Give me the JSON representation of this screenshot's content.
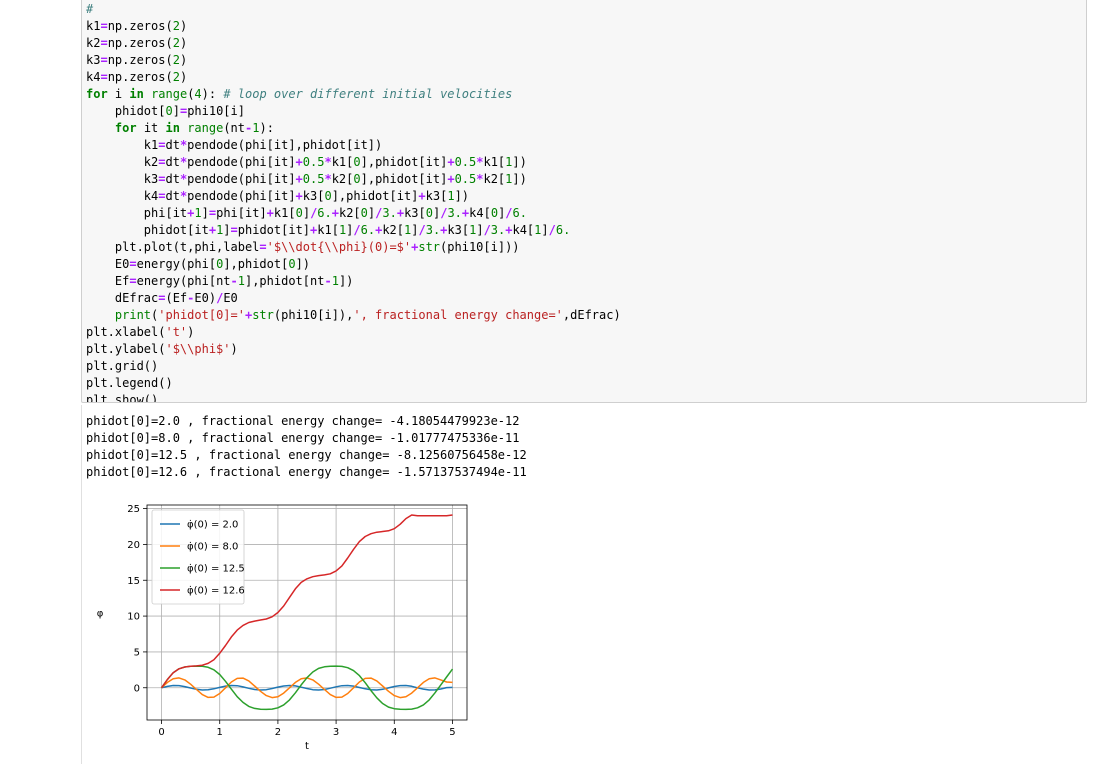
{
  "code_lines": [
    [
      {
        "t": "#",
        "c": "com"
      }
    ],
    [
      {
        "t": "k1",
        "c": ""
      },
      {
        "t": "=",
        "c": "op"
      },
      {
        "t": "np.zeros(",
        "c": ""
      },
      {
        "t": "2",
        "c": "num"
      },
      {
        "t": ")",
        "c": ""
      }
    ],
    [
      {
        "t": "k2",
        "c": ""
      },
      {
        "t": "=",
        "c": "op"
      },
      {
        "t": "np.zeros(",
        "c": ""
      },
      {
        "t": "2",
        "c": "num"
      },
      {
        "t": ")",
        "c": ""
      }
    ],
    [
      {
        "t": "k3",
        "c": ""
      },
      {
        "t": "=",
        "c": "op"
      },
      {
        "t": "np.zeros(",
        "c": ""
      },
      {
        "t": "2",
        "c": "num"
      },
      {
        "t": ")",
        "c": ""
      }
    ],
    [
      {
        "t": "k4",
        "c": ""
      },
      {
        "t": "=",
        "c": "op"
      },
      {
        "t": "np.zeros(",
        "c": ""
      },
      {
        "t": "2",
        "c": "num"
      },
      {
        "t": ")",
        "c": ""
      }
    ],
    [
      {
        "t": "for",
        "c": "kw"
      },
      {
        "t": " i ",
        "c": ""
      },
      {
        "t": "in",
        "c": "kw"
      },
      {
        "t": " ",
        "c": ""
      },
      {
        "t": "range",
        "c": "bi"
      },
      {
        "t": "(",
        "c": ""
      },
      {
        "t": "4",
        "c": "num"
      },
      {
        "t": "): ",
        "c": ""
      },
      {
        "t": "# loop over different initial velocities",
        "c": "com"
      }
    ],
    [
      {
        "t": "    phidot[",
        "c": ""
      },
      {
        "t": "0",
        "c": "num"
      },
      {
        "t": "]",
        "c": ""
      },
      {
        "t": "=",
        "c": "op"
      },
      {
        "t": "phi10[i]",
        "c": ""
      }
    ],
    [
      {
        "t": "    ",
        "c": ""
      },
      {
        "t": "for",
        "c": "kw"
      },
      {
        "t": " it ",
        "c": ""
      },
      {
        "t": "in",
        "c": "kw"
      },
      {
        "t": " ",
        "c": ""
      },
      {
        "t": "range",
        "c": "bi"
      },
      {
        "t": "(nt",
        "c": ""
      },
      {
        "t": "-",
        "c": "op"
      },
      {
        "t": "1",
        "c": "num"
      },
      {
        "t": "):",
        "c": ""
      }
    ],
    [
      {
        "t": "        k1",
        "c": ""
      },
      {
        "t": "=",
        "c": "op"
      },
      {
        "t": "dt",
        "c": ""
      },
      {
        "t": "*",
        "c": "op"
      },
      {
        "t": "pendode(phi[it],phidot[it])",
        "c": ""
      }
    ],
    [
      {
        "t": "        k2",
        "c": ""
      },
      {
        "t": "=",
        "c": "op"
      },
      {
        "t": "dt",
        "c": ""
      },
      {
        "t": "*",
        "c": "op"
      },
      {
        "t": "pendode(phi[it]",
        "c": ""
      },
      {
        "t": "+",
        "c": "op"
      },
      {
        "t": "0.5",
        "c": "num"
      },
      {
        "t": "*",
        "c": "op"
      },
      {
        "t": "k1[",
        "c": ""
      },
      {
        "t": "0",
        "c": "num"
      },
      {
        "t": "],phidot[it]",
        "c": ""
      },
      {
        "t": "+",
        "c": "op"
      },
      {
        "t": "0.5",
        "c": "num"
      },
      {
        "t": "*",
        "c": "op"
      },
      {
        "t": "k1[",
        "c": ""
      },
      {
        "t": "1",
        "c": "num"
      },
      {
        "t": "])",
        "c": ""
      }
    ],
    [
      {
        "t": "        k3",
        "c": ""
      },
      {
        "t": "=",
        "c": "op"
      },
      {
        "t": "dt",
        "c": ""
      },
      {
        "t": "*",
        "c": "op"
      },
      {
        "t": "pendode(phi[it]",
        "c": ""
      },
      {
        "t": "+",
        "c": "op"
      },
      {
        "t": "0.5",
        "c": "num"
      },
      {
        "t": "*",
        "c": "op"
      },
      {
        "t": "k2[",
        "c": ""
      },
      {
        "t": "0",
        "c": "num"
      },
      {
        "t": "],phidot[it]",
        "c": ""
      },
      {
        "t": "+",
        "c": "op"
      },
      {
        "t": "0.5",
        "c": "num"
      },
      {
        "t": "*",
        "c": "op"
      },
      {
        "t": "k2[",
        "c": ""
      },
      {
        "t": "1",
        "c": "num"
      },
      {
        "t": "])",
        "c": ""
      }
    ],
    [
      {
        "t": "        k4",
        "c": ""
      },
      {
        "t": "=",
        "c": "op"
      },
      {
        "t": "dt",
        "c": ""
      },
      {
        "t": "*",
        "c": "op"
      },
      {
        "t": "pendode(phi[it]",
        "c": ""
      },
      {
        "t": "+",
        "c": "op"
      },
      {
        "t": "k3[",
        "c": ""
      },
      {
        "t": "0",
        "c": "num"
      },
      {
        "t": "],phidot[it]",
        "c": ""
      },
      {
        "t": "+",
        "c": "op"
      },
      {
        "t": "k3[",
        "c": ""
      },
      {
        "t": "1",
        "c": "num"
      },
      {
        "t": "])",
        "c": ""
      }
    ],
    [
      {
        "t": "        phi[it",
        "c": ""
      },
      {
        "t": "+",
        "c": "op"
      },
      {
        "t": "1",
        "c": "num"
      },
      {
        "t": "]",
        "c": ""
      },
      {
        "t": "=",
        "c": "op"
      },
      {
        "t": "phi[it]",
        "c": ""
      },
      {
        "t": "+",
        "c": "op"
      },
      {
        "t": "k1[",
        "c": ""
      },
      {
        "t": "0",
        "c": "num"
      },
      {
        "t": "]",
        "c": ""
      },
      {
        "t": "/",
        "c": "op"
      },
      {
        "t": "6.",
        "c": "num"
      },
      {
        "t": "+",
        "c": "op"
      },
      {
        "t": "k2[",
        "c": ""
      },
      {
        "t": "0",
        "c": "num"
      },
      {
        "t": "]",
        "c": ""
      },
      {
        "t": "/",
        "c": "op"
      },
      {
        "t": "3.",
        "c": "num"
      },
      {
        "t": "+",
        "c": "op"
      },
      {
        "t": "k3[",
        "c": ""
      },
      {
        "t": "0",
        "c": "num"
      },
      {
        "t": "]",
        "c": ""
      },
      {
        "t": "/",
        "c": "op"
      },
      {
        "t": "3.",
        "c": "num"
      },
      {
        "t": "+",
        "c": "op"
      },
      {
        "t": "k4[",
        "c": ""
      },
      {
        "t": "0",
        "c": "num"
      },
      {
        "t": "]",
        "c": ""
      },
      {
        "t": "/",
        "c": "op"
      },
      {
        "t": "6.",
        "c": "num"
      }
    ],
    [
      {
        "t": "        phidot[it",
        "c": ""
      },
      {
        "t": "+",
        "c": "op"
      },
      {
        "t": "1",
        "c": "num"
      },
      {
        "t": "]",
        "c": ""
      },
      {
        "t": "=",
        "c": "op"
      },
      {
        "t": "phidot[it]",
        "c": ""
      },
      {
        "t": "+",
        "c": "op"
      },
      {
        "t": "k1[",
        "c": ""
      },
      {
        "t": "1",
        "c": "num"
      },
      {
        "t": "]",
        "c": ""
      },
      {
        "t": "/",
        "c": "op"
      },
      {
        "t": "6.",
        "c": "num"
      },
      {
        "t": "+",
        "c": "op"
      },
      {
        "t": "k2[",
        "c": ""
      },
      {
        "t": "1",
        "c": "num"
      },
      {
        "t": "]",
        "c": ""
      },
      {
        "t": "/",
        "c": "op"
      },
      {
        "t": "3.",
        "c": "num"
      },
      {
        "t": "+",
        "c": "op"
      },
      {
        "t": "k3[",
        "c": ""
      },
      {
        "t": "1",
        "c": "num"
      },
      {
        "t": "]",
        "c": ""
      },
      {
        "t": "/",
        "c": "op"
      },
      {
        "t": "3.",
        "c": "num"
      },
      {
        "t": "+",
        "c": "op"
      },
      {
        "t": "k4[",
        "c": ""
      },
      {
        "t": "1",
        "c": "num"
      },
      {
        "t": "]",
        "c": ""
      },
      {
        "t": "/",
        "c": "op"
      },
      {
        "t": "6.",
        "c": "num"
      }
    ],
    [
      {
        "t": "    plt.plot(t,phi,label",
        "c": ""
      },
      {
        "t": "=",
        "c": "op"
      },
      {
        "t": "'$\\\\dot{\\\\phi}(0)=$'",
        "c": "str"
      },
      {
        "t": "+",
        "c": "op"
      },
      {
        "t": "str",
        "c": "bi"
      },
      {
        "t": "(phi10[i]))",
        "c": ""
      }
    ],
    [
      {
        "t": "    E0",
        "c": ""
      },
      {
        "t": "=",
        "c": "op"
      },
      {
        "t": "energy(phi[",
        "c": ""
      },
      {
        "t": "0",
        "c": "num"
      },
      {
        "t": "],phidot[",
        "c": ""
      },
      {
        "t": "0",
        "c": "num"
      },
      {
        "t": "])",
        "c": ""
      }
    ],
    [
      {
        "t": "    Ef",
        "c": ""
      },
      {
        "t": "=",
        "c": "op"
      },
      {
        "t": "energy(phi[nt",
        "c": ""
      },
      {
        "t": "-",
        "c": "op"
      },
      {
        "t": "1",
        "c": "num"
      },
      {
        "t": "],phidot[nt",
        "c": ""
      },
      {
        "t": "-",
        "c": "op"
      },
      {
        "t": "1",
        "c": "num"
      },
      {
        "t": "])",
        "c": ""
      }
    ],
    [
      {
        "t": "    dEfrac",
        "c": ""
      },
      {
        "t": "=",
        "c": "op"
      },
      {
        "t": "(Ef",
        "c": ""
      },
      {
        "t": "-",
        "c": "op"
      },
      {
        "t": "E0)",
        "c": ""
      },
      {
        "t": "/",
        "c": "op"
      },
      {
        "t": "E0",
        "c": ""
      }
    ],
    [
      {
        "t": "    ",
        "c": ""
      },
      {
        "t": "print",
        "c": "bi"
      },
      {
        "t": "(",
        "c": ""
      },
      {
        "t": "'phidot[0]='",
        "c": "str"
      },
      {
        "t": "+",
        "c": "op"
      },
      {
        "t": "str",
        "c": "bi"
      },
      {
        "t": "(phi10[i]),",
        "c": ""
      },
      {
        "t": "', fractional energy change='",
        "c": "str"
      },
      {
        "t": ",dEfrac)",
        "c": ""
      }
    ],
    [
      {
        "t": "plt.xlabel(",
        "c": ""
      },
      {
        "t": "'t'",
        "c": "str"
      },
      {
        "t": ")",
        "c": ""
      }
    ],
    [
      {
        "t": "plt.ylabel(",
        "c": ""
      },
      {
        "t": "'$\\\\phi$'",
        "c": "str"
      },
      {
        "t": ")",
        "c": ""
      }
    ],
    [
      {
        "t": "plt.grid()",
        "c": ""
      }
    ],
    [
      {
        "t": "plt.legend()",
        "c": ""
      }
    ],
    [
      {
        "t": "plt.show()",
        "c": ""
      }
    ]
  ],
  "stdout_lines": [
    "phidot[0]=2.0 , fractional energy change= -4.18054479923e-12",
    "phidot[0]=8.0 , fractional energy change= -1.01777475336e-11",
    "phidot[0]=12.5 , fractional energy change= -8.12560756458e-12",
    "phidot[0]=12.6 , fractional energy change= -1.57137537494e-11"
  ],
  "chart_data": {
    "type": "line",
    "xlabel": "t",
    "ylabel": "φ",
    "xlim": [
      -0.25,
      5.25
    ],
    "ylim": [
      -4.5,
      25.5
    ],
    "xticks": [
      0,
      1,
      2,
      3,
      4,
      5
    ],
    "yticks": [
      0,
      5,
      10,
      15,
      20,
      25
    ],
    "grid": true,
    "legend_position": "upper-left",
    "x": [
      0,
      0.1,
      0.2,
      0.3,
      0.4,
      0.5,
      0.6,
      0.7,
      0.8,
      0.9,
      1.0,
      1.1,
      1.2,
      1.3,
      1.4,
      1.5,
      1.6,
      1.7,
      1.8,
      1.9,
      2.0,
      2.1,
      2.2,
      2.3,
      2.4,
      2.5,
      2.6,
      2.7,
      2.8,
      2.9,
      3.0,
      3.1,
      3.2,
      3.3,
      3.4,
      3.5,
      3.6,
      3.7,
      3.8,
      3.9,
      4.0,
      4.1,
      4.2,
      4.3,
      4.4,
      4.5,
      4.6,
      4.7,
      4.8,
      4.9,
      5.0
    ],
    "series": [
      {
        "name": "φ̇(0) = 2.0",
        "color": "#1f77b4",
        "values": [
          0.0,
          0.19,
          0.31,
          0.3,
          0.16,
          -0.03,
          -0.21,
          -0.31,
          -0.29,
          -0.14,
          0.05,
          0.23,
          0.32,
          0.28,
          0.12,
          -0.07,
          -0.24,
          -0.32,
          -0.27,
          -0.1,
          0.09,
          0.25,
          0.32,
          0.26,
          0.08,
          -0.11,
          -0.27,
          -0.32,
          -0.25,
          -0.06,
          0.13,
          0.28,
          0.32,
          0.23,
          0.04,
          -0.15,
          -0.29,
          -0.32,
          -0.22,
          -0.02,
          0.17,
          0.3,
          0.31,
          0.2,
          0.0,
          -0.19,
          -0.31,
          -0.3,
          -0.18,
          0.02,
          0.05
        ]
      },
      {
        "name": "φ̇(0) = 8.0",
        "color": "#ff7f0e",
        "values": [
          0.0,
          0.75,
          1.25,
          1.38,
          1.1,
          0.5,
          -0.25,
          -0.95,
          -1.35,
          -1.3,
          -0.8,
          0.0,
          0.8,
          1.3,
          1.35,
          0.95,
          0.25,
          -0.5,
          -1.1,
          -1.38,
          -1.25,
          -0.75,
          0.0,
          0.75,
          1.25,
          1.38,
          1.1,
          0.5,
          -0.25,
          -0.95,
          -1.35,
          -1.3,
          -0.8,
          0.0,
          0.8,
          1.3,
          1.35,
          0.95,
          0.25,
          -0.5,
          -1.1,
          -1.38,
          -1.25,
          -0.75,
          0.0,
          0.75,
          1.25,
          1.38,
          1.1,
          0.8,
          0.75
        ]
      },
      {
        "name": "φ̇(0) = 12.5",
        "color": "#2ca02c",
        "values": [
          0.0,
          1.15,
          2.1,
          2.65,
          2.9,
          3.0,
          3.02,
          3.0,
          2.85,
          2.5,
          1.85,
          0.9,
          -0.2,
          -1.25,
          -2.05,
          -2.6,
          -2.88,
          -3.0,
          -3.02,
          -2.98,
          -2.8,
          -2.4,
          -1.7,
          -0.7,
          0.4,
          1.4,
          2.2,
          2.7,
          2.92,
          3.0,
          3.02,
          2.98,
          2.8,
          2.4,
          1.7,
          0.7,
          -0.4,
          -1.4,
          -2.2,
          -2.7,
          -2.92,
          -3.0,
          -3.02,
          -2.98,
          -2.8,
          -2.4,
          -1.7,
          -0.7,
          0.4,
          1.5,
          2.6
        ]
      },
      {
        "name": "φ̇(0) = 12.6",
        "color": "#d62728",
        "values": [
          0.0,
          1.15,
          2.1,
          2.65,
          2.9,
          3.0,
          3.05,
          3.15,
          3.4,
          3.9,
          4.8,
          5.9,
          7.1,
          8.05,
          8.7,
          9.1,
          9.3,
          9.45,
          9.6,
          9.9,
          10.5,
          11.4,
          12.6,
          13.8,
          14.7,
          15.2,
          15.5,
          15.65,
          15.75,
          15.9,
          16.3,
          17.0,
          18.1,
          19.3,
          20.4,
          21.1,
          21.5,
          21.7,
          21.8,
          21.9,
          22.2,
          22.8,
          23.6,
          24.1,
          24.0,
          24.0,
          24.0,
          24.0,
          24.0,
          24.0,
          24.1
        ]
      }
    ]
  }
}
